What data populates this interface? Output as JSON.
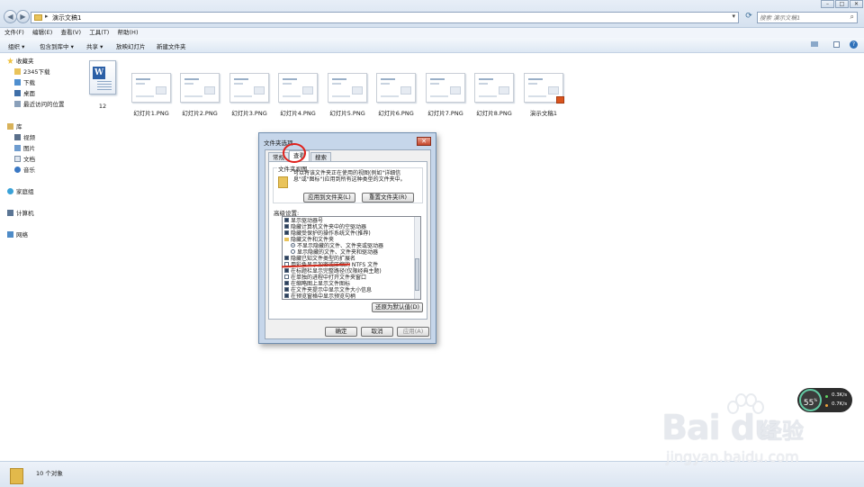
{
  "window": {
    "address_path": "演示文稿1",
    "search_placeholder": "搜索 演示文稿1"
  },
  "menubar": [
    "文件(F)",
    "编辑(E)",
    "查看(V)",
    "工具(T)",
    "帮助(H)"
  ],
  "toolbar": {
    "organize": "组织 ▾",
    "include": "包含到库中 ▾",
    "share": "共享 ▾",
    "slideshow": "放映幻灯片",
    "new_folder": "新建文件夹"
  },
  "sidebar": {
    "favorites": "收藏夹",
    "fav_items": [
      "2345下载",
      "下载",
      "桌面",
      "最近访问的位置"
    ],
    "library": "库",
    "lib_items": [
      "视频",
      "图片",
      "文档",
      "音乐"
    ],
    "homegroup": "家庭组",
    "computer": "计算机",
    "network": "网络"
  },
  "files": [
    {
      "name": "12",
      "type": "word-doc"
    },
    {
      "name": "幻灯片1.PNG",
      "type": "png"
    },
    {
      "name": "幻灯片2.PNG",
      "type": "png"
    },
    {
      "name": "幻灯片3.PNG",
      "type": "png"
    },
    {
      "name": "幻灯片4.PNG",
      "type": "png"
    },
    {
      "name": "幻灯片5.PNG",
      "type": "png"
    },
    {
      "name": "幻灯片6.PNG",
      "type": "png"
    },
    {
      "name": "幻灯片7.PNG",
      "type": "png"
    },
    {
      "name": "幻灯片8.PNG",
      "type": "png"
    },
    {
      "name": "演示文稿1",
      "type": "ppt"
    }
  ],
  "dialog": {
    "title": "文件夹选项",
    "close": "✕",
    "tabs": [
      "常规",
      "查看",
      "搜索"
    ],
    "active_tab": "查看",
    "group_title": "文件夹视图",
    "group_desc": "可以将该文件夹正在使用的视图(例如\"详细信息\"或\"图标\")应用到所有这种类型的文件夹中。",
    "apply_to_folders": "应用到文件夹(L)",
    "reset_folders": "重置文件夹(R)",
    "advanced_label": "高级设置:",
    "settings": [
      {
        "kind": "check",
        "on": true,
        "text": "显示驱动器号"
      },
      {
        "kind": "check",
        "on": true,
        "text": "隐藏计算机文件夹中的空驱动器"
      },
      {
        "kind": "check",
        "on": true,
        "text": "隐藏受保护的操作系统文件(推荐)"
      },
      {
        "kind": "folder",
        "on": false,
        "text": "隐藏文件和文件夹"
      },
      {
        "kind": "radio",
        "on": true,
        "text": "不显示隐藏的文件、文件夹或驱动器",
        "indent": true
      },
      {
        "kind": "radio",
        "on": false,
        "text": "显示隐藏的文件、文件夹和驱动器",
        "indent": true
      },
      {
        "kind": "check",
        "on": true,
        "text": "隐藏已知文件类型的扩展名"
      },
      {
        "kind": "check",
        "on": false,
        "text": "用彩色显示加密或压缩的 NTFS 文件"
      },
      {
        "kind": "check",
        "on": true,
        "text": "在标题栏显示完整路径(仅限经典主题)"
      },
      {
        "kind": "check",
        "on": false,
        "text": "在单独的进程中打开文件夹窗口"
      },
      {
        "kind": "check",
        "on": true,
        "text": "在缩略图上显示文件图标"
      },
      {
        "kind": "check",
        "on": true,
        "text": "在文件夹提示中显示文件大小信息"
      },
      {
        "kind": "check",
        "on": true,
        "text": "在预览窗格中显示预览句柄"
      }
    ],
    "restore_defaults": "还原为默认值(D)",
    "ok": "确定",
    "cancel": "取消",
    "apply": "应用(A)"
  },
  "status": {
    "items_count": "10 个对象"
  },
  "meter": {
    "percent": "55",
    "up": "0.3K/s",
    "down": "0.7K/s"
  },
  "watermark": {
    "logo": "Bai du",
    "jingyan": "经验",
    "url": "jingyan.baidu.com"
  },
  "colors": {
    "annotation_red": "#e0201b",
    "accent": "#2f71b9"
  }
}
